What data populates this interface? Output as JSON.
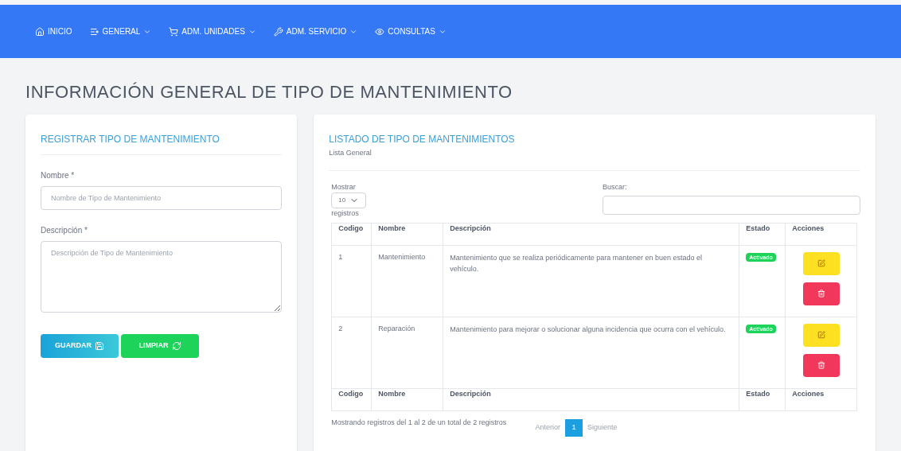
{
  "nav": [
    {
      "label": "INICIO",
      "dropdown": false
    },
    {
      "label": "GENERAL",
      "dropdown": true
    },
    {
      "label": "ADM. UNIDADES",
      "dropdown": true
    },
    {
      "label": "ADM. SERVICIO",
      "dropdown": true
    },
    {
      "label": "CONSULTAS",
      "dropdown": true
    }
  ],
  "page_title": "INFORMACIÓN GENERAL DE TIPO DE MANTENIMIENTO",
  "form": {
    "title": "REGISTRAR TIPO DE MANTENIMIENTO",
    "fields": [
      {
        "kind": "input",
        "label": "Nombre *",
        "placeholder": "Nombre de Tipo de Mantenimiento"
      },
      {
        "kind": "textarea",
        "label": "Descripción *",
        "placeholder": "Descripción de Tipo de Mantenimiento"
      }
    ],
    "buttons": [
      {
        "label": "GUARDAR",
        "kind": "save"
      },
      {
        "label": "LIMPIAR",
        "kind": "clear"
      }
    ]
  },
  "list": {
    "title": "LISTADO DE TIPO DE MANTENIMIENTOS",
    "subtitle": "Lista General",
    "show_label": "Mostrar",
    "show_value": "10",
    "show_suffix": "registros",
    "search_label": "Buscar:",
    "columns": [
      "Codigo",
      "Nombre",
      "Descripción",
      "Estado",
      "Acciones"
    ],
    "rows": [
      {
        "codigo": "1",
        "nombre": "Mantenimiento",
        "descripcion": "Mantenimiento que se realiza periódicamente para mantener en buen estado el vehículo.",
        "estado": "Activado"
      },
      {
        "codigo": "2",
        "nombre": "Reparación",
        "descripcion": "Mantenimiento para mejorar o solucionar alguna incidencia que ocurra con el vehículo.",
        "estado": "Activado"
      }
    ],
    "footer_columns": [
      "Codigo",
      "Nombre",
      "Descripción",
      "Estado",
      "Acciones"
    ],
    "info": "Mostrando registros del 1 al 2 de un total de 2 registros",
    "pagination": {
      "previous": "Anterior",
      "pages": [
        {
          "label": "1",
          "selected": true
        }
      ],
      "next": "Siguiente"
    }
  }
}
